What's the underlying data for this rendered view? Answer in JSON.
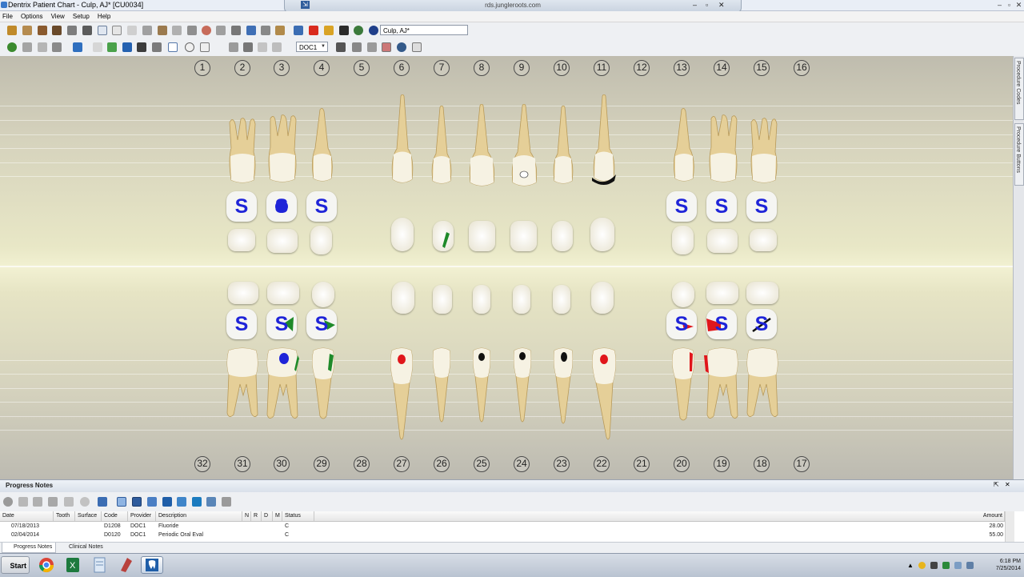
{
  "window": {
    "title": "Dentrix Patient Chart - Culp, AJ* [CU0034]",
    "remote_host": "rds.jungleroots.com",
    "minimize": "–",
    "maximize": "▫",
    "close": "✕"
  },
  "menu": [
    "File",
    "Options",
    "View",
    "Setup",
    "Help"
  ],
  "toolbar": {
    "patient_combo": "Culp, AJ*",
    "provider_combo": "DOC1"
  },
  "chart": {
    "upper_numbers": [
      "1",
      "2",
      "3",
      "4",
      "5",
      "6",
      "7",
      "8",
      "9",
      "10",
      "11",
      "12",
      "13",
      "14",
      "15",
      "16"
    ],
    "lower_numbers": [
      "32",
      "31",
      "30",
      "29",
      "28",
      "27",
      "26",
      "25",
      "24",
      "23",
      "22",
      "21",
      "20",
      "19",
      "18",
      "17"
    ],
    "sealant_letter": "S"
  },
  "side_panel": {
    "tab1": "Procedure Codes",
    "tab2": "Procedure Buttons"
  },
  "progress_notes": {
    "title": "Progress Notes",
    "pin": "⇱",
    "close": "✕",
    "columns": [
      "Date",
      "Tooth",
      "Surface",
      "Code",
      "Provider",
      "Description",
      "N",
      "R",
      "D",
      "M",
      "Status",
      "Amount"
    ],
    "rows": [
      {
        "date": "07/18/2013",
        "tooth": "",
        "surface": "",
        "code": "D1208",
        "provider": "DOC1",
        "description": "Fluoride",
        "status": "C",
        "amount": "28.00"
      },
      {
        "date": "02/04/2014",
        "tooth": "",
        "surface": "",
        "code": "D0120",
        "provider": "DOC1",
        "description": "Periodic Oral Eval",
        "status": "C",
        "amount": "55.00"
      }
    ],
    "tabs": [
      "Progress Notes",
      "Clinical Notes"
    ]
  },
  "taskbar": {
    "start": "Start",
    "time": "6:18 PM",
    "date": "7/25/2014"
  },
  "colors": {
    "sealant": "#1f24d8",
    "caries_red": "#e0161b",
    "restoration_green": "#1f8a2a",
    "amalgam_blue": "#1f24d8"
  }
}
